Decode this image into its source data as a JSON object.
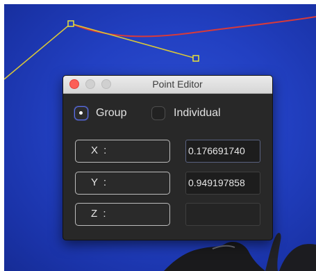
{
  "colors": {
    "canvas_background": "#2240c2",
    "spline_red": "#d83a3a",
    "path_yellow": "#d8c63a",
    "control_point": "#e8e23a",
    "close_button": "#fc5f57",
    "radio_selected_border": "#5a6ee8"
  },
  "icons": {
    "control_point": "square-handle-icon",
    "close": "close-icon",
    "minimize": "minimize-icon",
    "zoom": "zoom-icon",
    "radio_selected": "radio-selected-icon",
    "radio_unselected": "radio-unselected-icon"
  },
  "point_editor": {
    "title": "Point Editor",
    "mode": {
      "group_label": "Group",
      "individual_label": "Individual",
      "selected": "Group"
    },
    "axes": [
      {
        "label": "X :",
        "value": "0.176691740"
      },
      {
        "label": "Y :",
        "value": "0.949197858"
      },
      {
        "label": "Z :",
        "value": ""
      }
    ]
  }
}
